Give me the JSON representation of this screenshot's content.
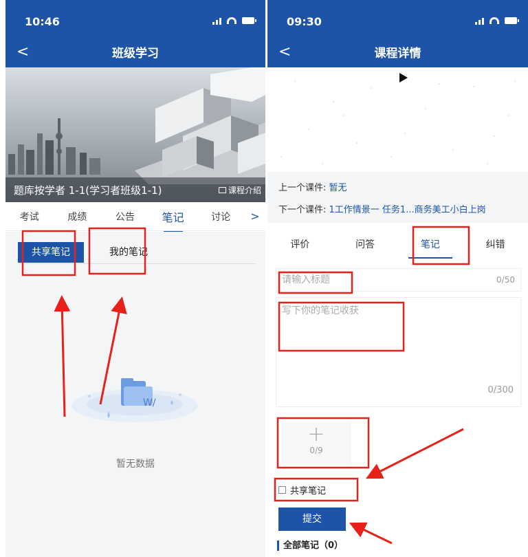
{
  "left": {
    "status": {
      "time": "10:46"
    },
    "nav": {
      "back": "<",
      "title": "班级学习"
    },
    "banner": {
      "course_name": "题库按学者 1-1(学习者班级1-1)",
      "intro_label": "课程介绍"
    },
    "tabs": [
      "考试",
      "成绩",
      "公告",
      "笔记",
      "讨论"
    ],
    "active_tab": "笔记",
    "more_icon": ">",
    "subtabs": {
      "shared": "共享笔记",
      "mine": "我的笔记"
    },
    "empty_text": "暂无数据"
  },
  "right": {
    "status": {
      "time": "09:30"
    },
    "nav": {
      "back": "<",
      "title": "课程详情"
    },
    "courseware": {
      "prev_label": "上一个课件: ",
      "prev_value": "暂无",
      "next_label": "下一个课件: ",
      "next_value": "1工作情景一 任务1...商务美工小白上岗"
    },
    "tabs": [
      "评价",
      "问答",
      "笔记",
      "纠错"
    ],
    "active_tab": "笔记",
    "note_title": {
      "placeholder": "请输入标题",
      "count": "0/50"
    },
    "note_body": {
      "placeholder": "写下你的笔记收获",
      "count": "0/300"
    },
    "upload": {
      "plus": "+",
      "count": "0/9"
    },
    "share_label": "共享笔记",
    "submit_label": "提交",
    "all_notes": "全部笔记（0）"
  },
  "colors": {
    "primary": "#1e54a8",
    "annotation": "#e8201a",
    "background": "#f4f5f7"
  },
  "icons": [
    "signal-icon",
    "wifi-icon",
    "battery-icon",
    "back-icon",
    "chevron-right-icon",
    "play-icon",
    "plus-icon",
    "checkbox-icon"
  ]
}
